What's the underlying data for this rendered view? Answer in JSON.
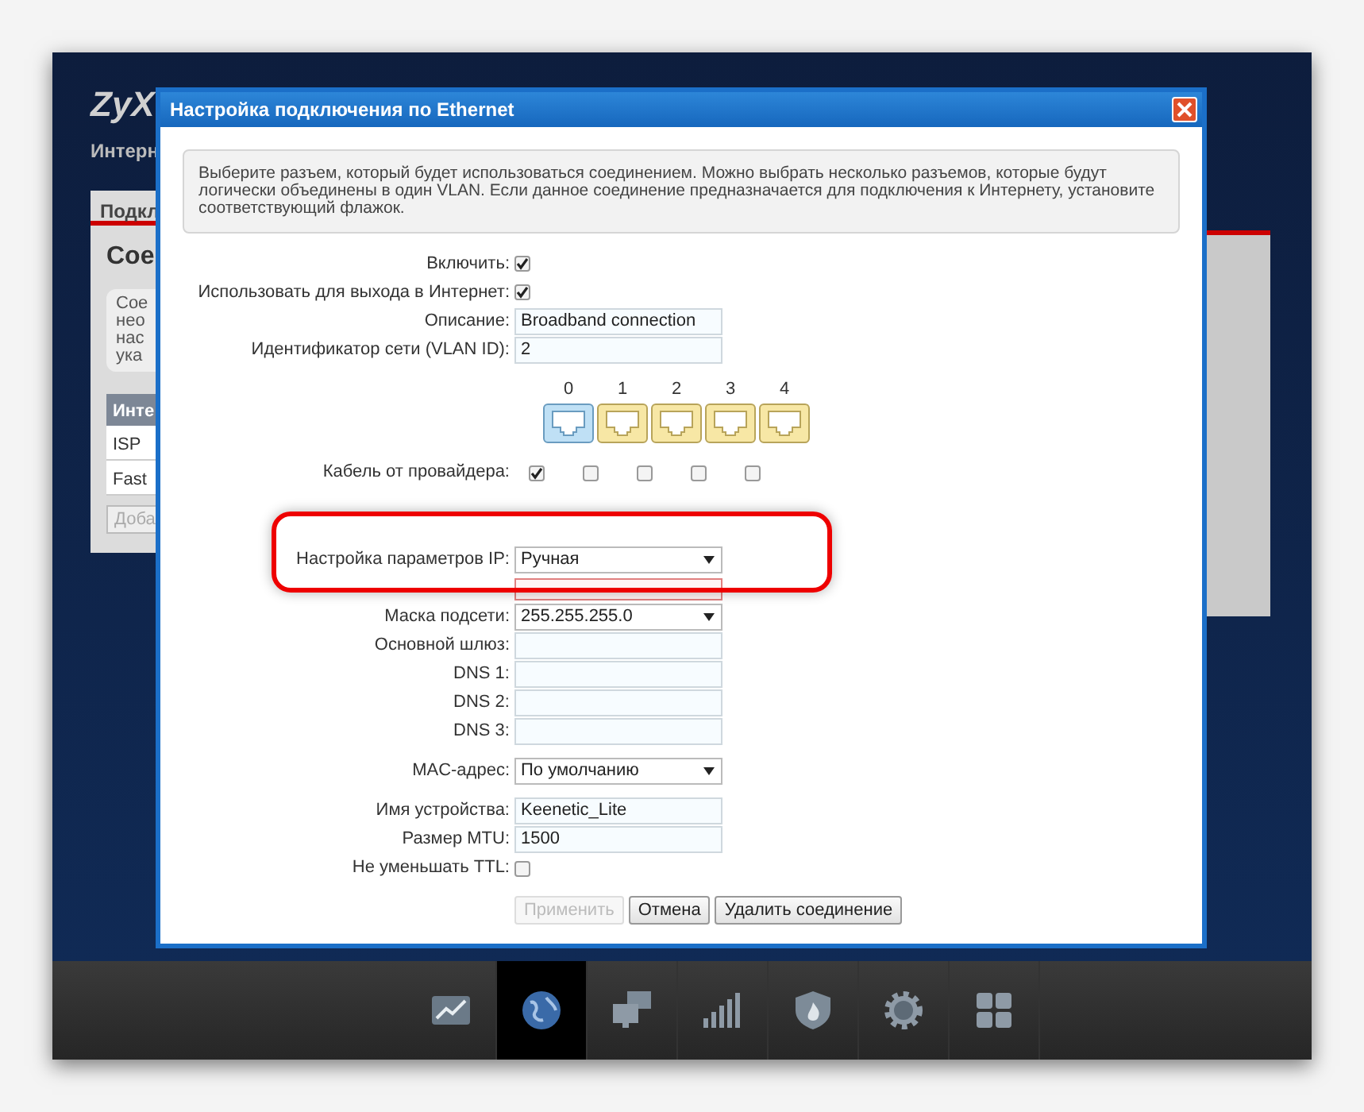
{
  "background": {
    "logo": "ZyX",
    "section": "Интерн",
    "tab": "Подкл",
    "heading": "Сое",
    "description_lines": [
      "Сое",
      "нео",
      "нас",
      "ука"
    ],
    "table_header": "Инте",
    "table_rows": [
      "ISP",
      "Fast"
    ],
    "add_button": "Доба"
  },
  "dialog": {
    "title": "Настройка подключения по Ethernet",
    "info": "Выберите разъем, который будет использоваться соединением. Можно выбрать несколько разъемов, которые будут логически объединены в один VLAN. Если данное соединение предназначается для подключения к Интернету, установите соответствующий флажок.",
    "fields_top": [
      {
        "kind": "checkbox",
        "label": "Включить:",
        "checked": true
      },
      {
        "kind": "checkbox",
        "label": "Использовать для выхода в Интернет:",
        "checked": true
      },
      {
        "kind": "text",
        "label": "Описание:",
        "value": "Broadband connection"
      },
      {
        "kind": "text",
        "label": "Идентификатор сети (VLAN ID):",
        "value": "2"
      }
    ],
    "ports": [
      {
        "number": "0",
        "wan": true
      },
      {
        "number": "1",
        "wan": false
      },
      {
        "number": "2",
        "wan": false
      },
      {
        "number": "3",
        "wan": false
      },
      {
        "number": "4",
        "wan": false
      }
    ],
    "cable_label": "Кабель от провайдера:",
    "cable": [
      true,
      false,
      false,
      false,
      false
    ],
    "ip_setting": {
      "label": "Настройка параметров IP:",
      "value": "Ручная"
    },
    "fields_ip": [
      {
        "kind": "select",
        "label": "Маска подсети:",
        "value": "255.255.255.0"
      },
      {
        "kind": "text",
        "label": "Основной шлюз:"
      },
      {
        "kind": "text",
        "label": "DNS 1:"
      },
      {
        "kind": "text",
        "label": "DNS 2:"
      },
      {
        "kind": "text",
        "label": "DNS 3:"
      },
      {
        "kind": "gap"
      },
      {
        "kind": "select",
        "label": "MAC-адрес:",
        "value": "По умолчанию"
      },
      {
        "kind": "gap"
      },
      {
        "kind": "text",
        "label": "Имя устройства:",
        "value": "Keenetic_Lite"
      },
      {
        "kind": "text",
        "label": "Размер MTU:",
        "value": "1500"
      },
      {
        "kind": "checkbox",
        "label": "Не уменьшать TTL:",
        "checked": false
      }
    ],
    "buttons": [
      {
        "label": "Применить",
        "disabled": true
      },
      {
        "label": "Отмена",
        "disabled": false
      },
      {
        "label": "Удалить соединение",
        "disabled": false
      }
    ]
  },
  "toolbar": [
    {
      "kind": "chart",
      "selected": false
    },
    {
      "kind": "globe",
      "selected": true
    },
    {
      "kind": "monitors",
      "selected": false
    },
    {
      "kind": "signal",
      "selected": false
    },
    {
      "kind": "shield",
      "selected": false
    },
    {
      "kind": "gear",
      "selected": false
    },
    {
      "kind": "grid",
      "selected": false
    }
  ]
}
